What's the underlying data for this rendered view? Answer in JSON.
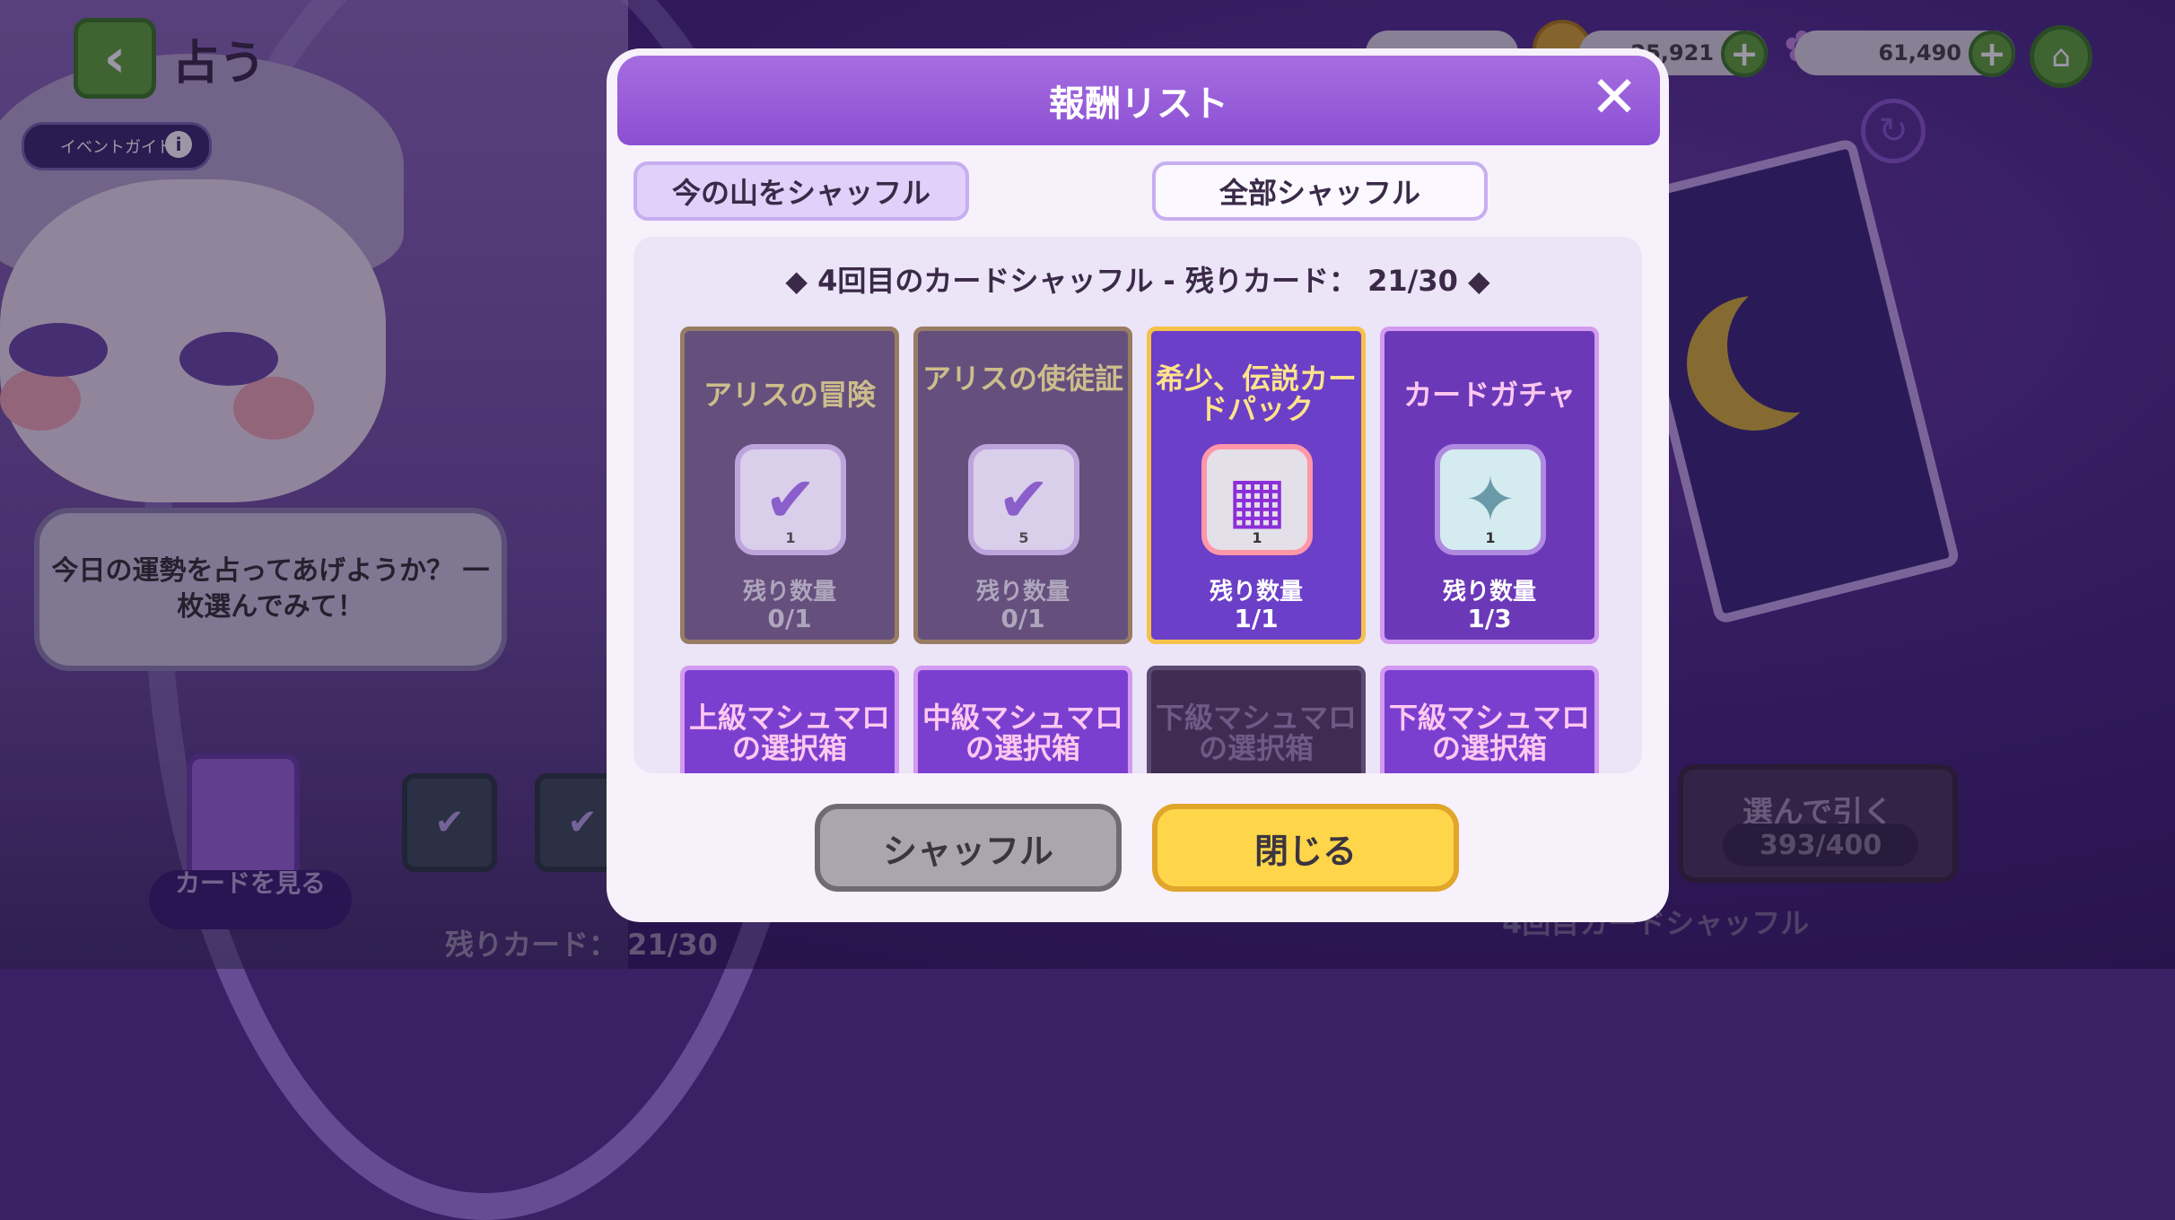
{
  "header": {
    "title": "占う",
    "event_guide": "イベントガイド",
    "currency_1": "25,921",
    "currency_2": "61,490"
  },
  "speech": "今日の運勢を占ってあげようか？ 一枚選んでみて！",
  "modal": {
    "title": "報酬リスト",
    "tabs": [
      "今の山をシャッフル",
      "全部シャッフル"
    ],
    "subtitle": "◆ 4回目のカードシャッフル - 残りカード： 21/30 ◆",
    "remain_label": "残り数量",
    "rewards": [
      {
        "name": "アリスの冒険",
        "icon": "check-ticket-icon",
        "qty": "1",
        "remain": "0/1",
        "state": "depleted"
      },
      {
        "name": "アリスの使徒証",
        "icon": "check-ticket-icon",
        "qty": "5",
        "remain": "0/1",
        "state": "depleted"
      },
      {
        "name": "希少、伝説カードパック",
        "icon": "card-pack-icon",
        "qty": "1",
        "remain": "1/1",
        "state": "rare"
      },
      {
        "name": "カードガチャ",
        "icon": "gacha-ticket-icon",
        "qty": "1",
        "remain": "1/3",
        "state": "available"
      }
    ],
    "rewards_row2": [
      {
        "name": "上級マシュマロの選択箱",
        "state": "available"
      },
      {
        "name": "中級マシュマロの選択箱",
        "state": "available"
      },
      {
        "name": "下級マシュマロの選択箱",
        "state": "depleted"
      },
      {
        "name": "下級マシュマロの選択箱",
        "state": "available"
      }
    ],
    "shuffle_button": "シャッフル",
    "close_button": "閉じる"
  },
  "background": {
    "pick_button": "選んで引く",
    "pick_count": "393/400",
    "view_cards": "カードを見る",
    "remaining_cards": "残りカード： 21/30",
    "shuffle_info": "4回目カードシャッフル"
  },
  "colors": {
    "header_purple": "#8b4fd3",
    "confirm_yellow": "#ffd64a",
    "green_button": "#5fa83a"
  }
}
